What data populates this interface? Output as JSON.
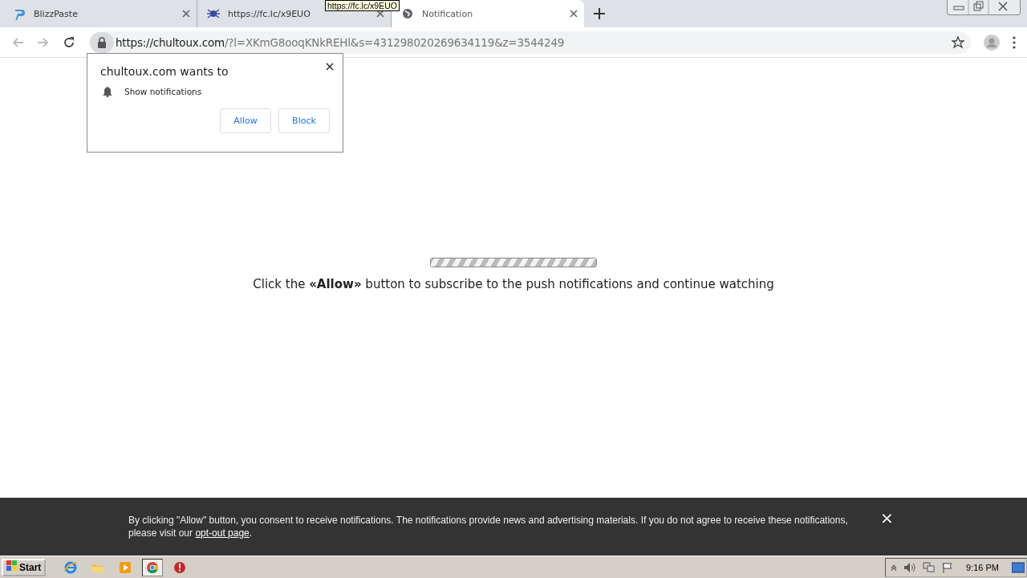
{
  "browser": {
    "tabs": [
      {
        "title": "BlizzPaste",
        "kind": "blizz",
        "selected": false
      },
      {
        "title": "https://fc.lc/x9EUO",
        "kind": "bug",
        "selected": false
      },
      {
        "title": "Notification",
        "kind": "globe",
        "selected": true
      }
    ],
    "tooltip": "https://fc.lc/x9EUO",
    "address": {
      "host": "https://chultoux.com",
      "path": "/?l=XKmG8ooqKNkREHl&s=431298020269634119&z=3544249"
    }
  },
  "permission_popup": {
    "title": "chultoux.com wants to",
    "permission": "Show notifications",
    "buttons": [
      "Allow",
      "Block"
    ]
  },
  "page": {
    "progress": {
      "level": 1
    },
    "message": "Click the **«Allow»** button to subscribe to the push notifications and continue watching"
  },
  "banner": {
    "text": "By clicking \"Allow\" button, you consent to receive notifications. The notifications provide news and advertising materials. If you do not agree to receive these notifications, please visit our",
    "link": "opt-out page",
    "after": ".",
    "close": "×"
  },
  "taskbar": {
    "start": "Start",
    "apps": [
      {
        "kind": "ie",
        "selected": false
      },
      {
        "kind": "folder",
        "selected": false
      },
      {
        "kind": "media",
        "selected": false
      },
      {
        "kind": "chrome",
        "selected": true
      },
      {
        "kind": "stop",
        "selected": false
      }
    ],
    "clock": "9:16 PM"
  }
}
